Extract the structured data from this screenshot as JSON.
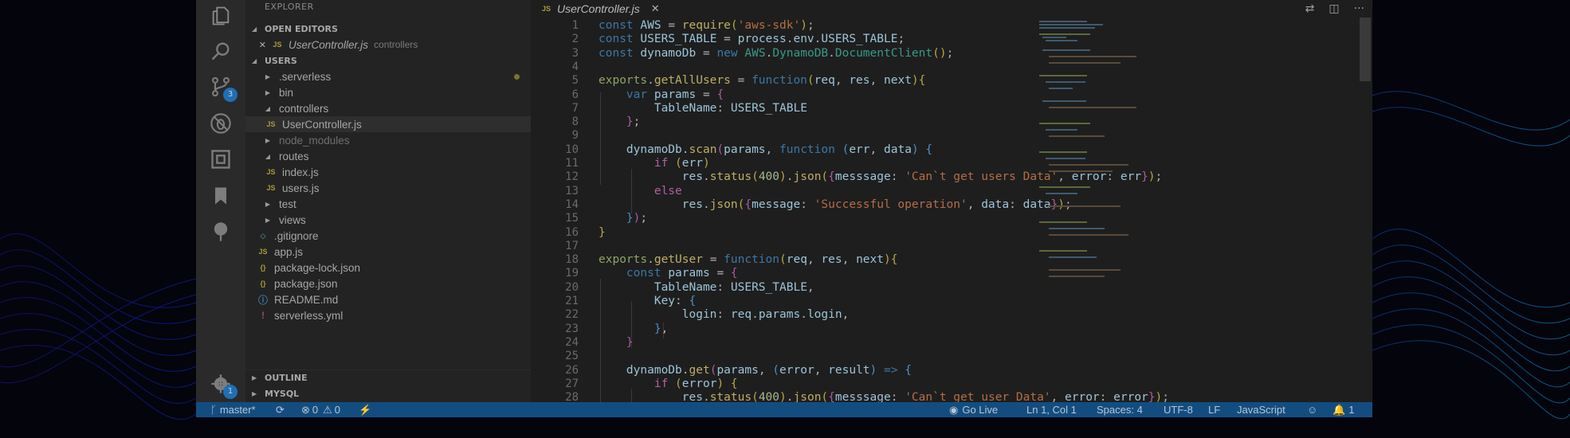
{
  "editor_tab": {
    "icon": "JS",
    "filename": "UserController.js",
    "close": "✕"
  },
  "explorer": {
    "title": "EXPLORER",
    "open_editors": {
      "label": "OPEN EDITORS",
      "items": [
        {
          "close": "✕",
          "icon": "JS",
          "name": "UserController.js",
          "description": "controllers"
        }
      ]
    },
    "project": {
      "label": "USERS",
      "items": [
        {
          "name": ".serverless",
          "type": "folder",
          "state": "collapsed",
          "modified": true
        },
        {
          "name": "bin",
          "type": "folder",
          "state": "collapsed"
        },
        {
          "name": "controllers",
          "type": "folder",
          "state": "expanded"
        },
        {
          "name": "UserController.js",
          "type": "js",
          "icon": "JS",
          "selected": true
        },
        {
          "name": "node_modules",
          "type": "folder",
          "state": "collapsed",
          "dimmed": true
        },
        {
          "name": "routes",
          "type": "folder",
          "state": "expanded"
        },
        {
          "name": "index.js",
          "type": "js",
          "icon": "JS"
        },
        {
          "name": "users.js",
          "type": "js",
          "icon": "JS"
        },
        {
          "name": "test",
          "type": "folder",
          "state": "collapsed"
        },
        {
          "name": "views",
          "type": "folder",
          "state": "collapsed"
        },
        {
          "name": ".gitignore",
          "type": "git",
          "icon": "◇"
        },
        {
          "name": "app.js",
          "type": "js",
          "icon": "JS"
        },
        {
          "name": "package-lock.json",
          "type": "json",
          "icon": "{}"
        },
        {
          "name": "package.json",
          "type": "json",
          "icon": "{}"
        },
        {
          "name": "README.md",
          "type": "info",
          "icon": "ⓘ"
        },
        {
          "name": "serverless.yml",
          "type": "yml",
          "icon": "!"
        }
      ]
    },
    "outline_label": "OUTLINE",
    "mysql_label": "MYSQL"
  },
  "activity_bar": {
    "icons": [
      "files-icon",
      "search-icon",
      "source-control-icon",
      "debug-icon",
      "extensions-icon",
      "bookmark-icon",
      "tree-icon",
      "settings-gear-icon"
    ],
    "source_control_badge": "3",
    "settings_badge": "1"
  },
  "code_lines": [
    {
      "n": "1",
      "html": "<span class=\"k\">const</span> <span class=\"v\">AWS</span> <span class=\"w\">=</span> <span class=\"f\">require</span><span class=\"p\">(</span><span class=\"s\">'aws-sdk'</span><span class=\"p\">)</span><span class=\"w\">;</span>"
    },
    {
      "n": "2",
      "html": "<span class=\"k\">const</span> <span class=\"v\">USERS_TABLE</span> <span class=\"w\">=</span> <span class=\"v\">process</span><span class=\"w\">.</span><span class=\"v\">env</span><span class=\"w\">.</span><span class=\"v\">USERS_TABLE</span><span class=\"w\">;</span>"
    },
    {
      "n": "3",
      "html": "<span class=\"k\">const</span> <span class=\"v\">dynamoDb</span> <span class=\"w\">=</span> <span class=\"k\">new</span> <span class=\"c\">AWS</span><span class=\"w\">.</span><span class=\"c\">DynamoDB</span><span class=\"w\">.</span><span class=\"c\">DocumentClient</span><span class=\"p\">()</span><span class=\"w\">;</span>"
    },
    {
      "n": "4",
      "html": ""
    },
    {
      "n": "5",
      "html": "<span class=\"e\">exports</span><span class=\"w\">.</span><span class=\"f\">getAllUsers</span> <span class=\"w\">=</span> <span class=\"k\">function</span><span class=\"p\">(</span><span class=\"v\">req</span><span class=\"w\">,</span> <span class=\"v\">res</span><span class=\"w\">,</span> <span class=\"v\">next</span><span class=\"p\">){</span>"
    },
    {
      "n": "6",
      "html": "    <span class=\"k\">var</span> <span class=\"v\">params</span> <span class=\"w\">=</span> <span class=\"p2\">{</span>"
    },
    {
      "n": "7",
      "html": "        <span class=\"v\">TableName</span><span class=\"w\">:</span> <span class=\"v\">USERS_TABLE</span>"
    },
    {
      "n": "8",
      "html": "    <span class=\"p2\">}</span><span class=\"w\">;</span>"
    },
    {
      "n": "9",
      "html": ""
    },
    {
      "n": "10",
      "html": "    <span class=\"v\">dynamoDb</span><span class=\"w\">.</span><span class=\"f\">scan</span><span class=\"p2\">(</span><span class=\"v\">params</span><span class=\"w\">,</span> <span class=\"k\">function</span> <span class=\"p3\">(</span><span class=\"v\">err</span><span class=\"w\">,</span> <span class=\"v\">data</span><span class=\"p3\">)</span> <span class=\"p3\">{</span>"
    },
    {
      "n": "11",
      "html": "        <span class=\"d\">if</span> <span class=\"p\">(</span><span class=\"v\">err</span><span class=\"p\">)</span>"
    },
    {
      "n": "12",
      "html": "            <span class=\"v\">res</span><span class=\"w\">.</span><span class=\"f\">status</span><span class=\"p\">(</span><span class=\"n\">400</span><span class=\"p\">)</span><span class=\"w\">.</span><span class=\"f\">json</span><span class=\"p\">(</span><span class=\"p2\">{</span><span class=\"v\">messsage</span><span class=\"w\">:</span> <span class=\"s\">'Can`t get users Data'</span><span class=\"w\">,</span> <span class=\"v\">error</span><span class=\"w\">:</span> <span class=\"v\">err</span><span class=\"p2\">}</span><span class=\"p\">)</span><span class=\"w\">;</span>"
    },
    {
      "n": "13",
      "html": "        <span class=\"d\">else</span>"
    },
    {
      "n": "14",
      "html": "            <span class=\"v\">res</span><span class=\"w\">.</span><span class=\"f\">json</span><span class=\"p\">(</span><span class=\"p2\">{</span><span class=\"v\">message</span><span class=\"w\">:</span> <span class=\"s\">'Successful operation'</span><span class=\"w\">,</span> <span class=\"v\">data</span><span class=\"w\">:</span> <span class=\"v\">data</span><span class=\"p2\">}</span><span class=\"p\">)</span><span class=\"w\">;</span>"
    },
    {
      "n": "15",
      "html": "    <span class=\"p3\">}</span><span class=\"p2\">)</span><span class=\"w\">;</span>"
    },
    {
      "n": "16",
      "html": "<span class=\"p\">}</span>"
    },
    {
      "n": "17",
      "html": ""
    },
    {
      "n": "18",
      "html": "<span class=\"e\">exports</span><span class=\"w\">.</span><span class=\"f\">getUser</span> <span class=\"w\">=</span> <span class=\"k\">function</span><span class=\"p\">(</span><span class=\"v\">req</span><span class=\"w\">,</span> <span class=\"v\">res</span><span class=\"w\">,</span> <span class=\"v\">next</span><span class=\"p\">){</span>"
    },
    {
      "n": "19",
      "html": "    <span class=\"k\">const</span> <span class=\"v\">params</span> <span class=\"w\">=</span> <span class=\"p2\">{</span>"
    },
    {
      "n": "20",
      "html": "        <span class=\"v\">TableName</span><span class=\"w\">:</span> <span class=\"v\">USERS_TABLE</span><span class=\"w\">,</span>"
    },
    {
      "n": "21",
      "html": "        <span class=\"v\">Key</span><span class=\"w\">:</span> <span class=\"p3\">{</span>"
    },
    {
      "n": "22",
      "html": "            <span class=\"v\">login</span><span class=\"w\">:</span> <span class=\"v\">req</span><span class=\"w\">.</span><span class=\"v\">params</span><span class=\"w\">.</span><span class=\"v\">login</span><span class=\"w\">,</span>"
    },
    {
      "n": "23",
      "html": "        <span class=\"p3\">}</span><span class=\"w\">,</span>"
    },
    {
      "n": "24",
      "html": "    <span class=\"p2\">}</span>"
    },
    {
      "n": "25",
      "html": ""
    },
    {
      "n": "26",
      "html": "    <span class=\"v\">dynamoDb</span><span class=\"w\">.</span><span class=\"f\">get</span><span class=\"p2\">(</span><span class=\"v\">params</span><span class=\"w\">,</span> <span class=\"p3\">(</span><span class=\"v\">error</span><span class=\"w\">,</span> <span class=\"v\">result</span><span class=\"p3\">)</span> <span class=\"k\">=&gt;</span> <span class=\"p3\">{</span>"
    },
    {
      "n": "27",
      "html": "        <span class=\"d\">if</span> <span class=\"p\">(</span><span class=\"v\">error</span><span class=\"p\">)</span> <span class=\"p\">{</span>"
    },
    {
      "n": "28",
      "html": "            <span class=\"v\">res</span><span class=\"w\">.</span><span class=\"f\">status</span><span class=\"p\">(</span><span class=\"n\">400</span><span class=\"p\">)</span><span class=\"w\">.</span><span class=\"f\">json</span><span class=\"p\">(</span><span class=\"p2\">{</span><span class=\"v\">messsage</span><span class=\"w\">:</span> <span class=\"s\">'Can`t get user Data'</span><span class=\"w\">,</span> <span class=\"v\">error</span><span class=\"w\">:</span> <span class=\"v\">error</span><span class=\"p2\">}</span><span class=\"p\">)</span><span class=\"w\">;</span>"
    }
  ],
  "status_bar": {
    "branch": "master*",
    "sync_icon": "⟳",
    "errors": "0",
    "warnings": "0",
    "bolt": "⚡",
    "go_live": "Go Live",
    "position": "Ln 1, Col 1",
    "spaces": "Spaces: 4",
    "encoding": "UTF-8",
    "eol": "LF",
    "language": "JavaScript",
    "notifications": "1"
  },
  "colors": {
    "status_bar": "#134d80",
    "editor_bg": "#1e1e1e",
    "sidebar_bg": "#232323"
  }
}
